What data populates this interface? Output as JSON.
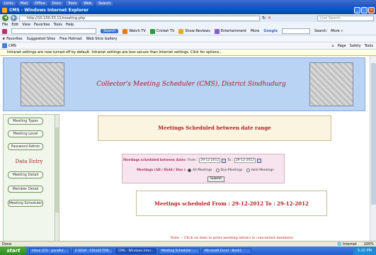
{
  "browser": {
    "window_title": "CMS - Windows Internet Explorer",
    "url": "http://10.150.33.11/meeting.php",
    "search_placeholder": "Live Search",
    "menu": [
      "File",
      "Edit",
      "View",
      "Favorites",
      "Tools",
      "Help"
    ],
    "toolbar": {
      "search_button": "Search",
      "items": [
        "Watch TV",
        "Cricket TV",
        "Show Reviews",
        "Entertainment"
      ],
      "more": "More",
      "google": "Google",
      "search2": "Search",
      "more2": "More »"
    },
    "favorites": {
      "label": "Favorites",
      "items": [
        "Suggested Sites",
        "Free Hotmail",
        "Web Slice Gallery"
      ]
    },
    "tab_label": "CMS",
    "page_tools": [
      "Page",
      "Safety",
      "Tools"
    ],
    "infobar": "Intranet settings are now turned off by default. Intranet settings are less secure than Internet settings. Click for options..."
  },
  "banner": {
    "title": "Collector's Meeting Scheduler (CMS), District Sindhudurg"
  },
  "sidebar": {
    "top_buttons": [
      "Meeting Types",
      "Meeting Level",
      "Password Admin"
    ],
    "section_heading": "Data Entry",
    "bottom_buttons": [
      "Meeting Detail",
      "Member Detail",
      "Meeting Scheduler"
    ]
  },
  "main": {
    "heading": "Meetings Scheduled between date range",
    "form": {
      "dates_label": "Meetings scheduled between dates",
      "from_label": "From :",
      "from_value": "29-12-2012",
      "to_label": "To :",
      "to_value": "29-12-2012",
      "type_label": "Meetings (All / Held / Due )",
      "options": [
        "All Meetings",
        "Due Meetings",
        "Held Meetings"
      ],
      "selected_option": "All Meetings",
      "submit": "Submit"
    },
    "result": "Meetings scheduled From : 29-12-2012 To : 29-12-2012",
    "note": "Note :- Click on date to print meeting letters to concerned members."
  },
  "statusbar": {
    "left": "Done",
    "zone": "Internet",
    "zoom": "100%"
  },
  "taskbar": {
    "start": "start",
    "tasks": [
      "Inbox (23) - pandhir...",
      "E-SEVA - COLLECTOR...",
      "CMS - Windows Inter...",
      "Meeting Scheduler -...",
      "Microsoft Excel - Book1"
    ],
    "clock": "5:15 PM"
  }
}
